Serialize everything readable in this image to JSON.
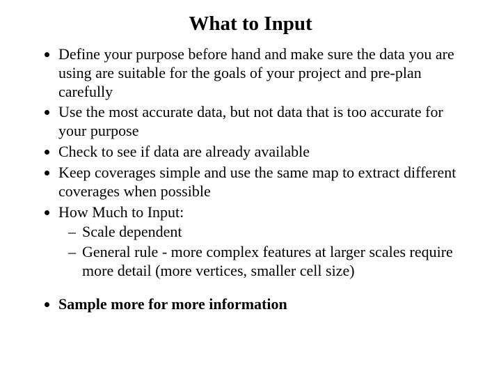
{
  "title": "What to Input",
  "bullets": {
    "b1": "Define your purpose before hand and make sure the data you are using are suitable for the goals of your project and pre-plan carefully",
    "b2": "Use the most accurate data, but not data that is too accurate for your purpose",
    "b3": "Check to see if data are already available",
    "b4": "Keep coverages simple and use the same map to extract different coverages when possible",
    "b5": "How Much to Input:",
    "b5_sub": {
      "s1": "Scale dependent",
      "s2": "General rule - more complex features at larger scales require more detail (more vertices, smaller cell size)"
    },
    "b6": "Sample more for more information"
  }
}
